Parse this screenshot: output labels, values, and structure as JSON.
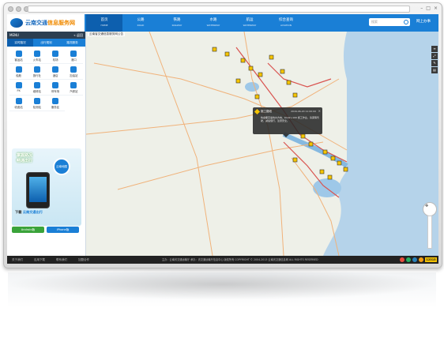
{
  "header": {
    "logo_text": "云南交通",
    "logo_sub": "信息服务网",
    "tabs": [
      {
        "cn": "首页",
        "en": "HOME"
      },
      {
        "cn": "公路",
        "en": "ROAD"
      },
      {
        "cn": "铁路",
        "en": "RAILWAY"
      },
      {
        "cn": "水路",
        "en": "WATERWAY"
      },
      {
        "cn": "航运",
        "en": "WATERWAY"
      },
      {
        "cn": "综合查询",
        "en": "AVIATION"
      }
    ],
    "search_placeholder": "搜索",
    "online_label": "网上办事"
  },
  "sidebar": {
    "menu_label": "MENU",
    "menu_right": "« 返回",
    "tabs": [
      "实时路况",
      "出行规划",
      "路况服务"
    ],
    "grid": [
      {
        "label": "客运站",
        "icon": "bus-icon"
      },
      {
        "label": "火车站",
        "icon": "train-icon"
      },
      {
        "label": "机场",
        "icon": "plane-icon"
      },
      {
        "label": "港口",
        "icon": "port-icon"
      },
      {
        "label": "船舶",
        "icon": "ship-icon"
      },
      {
        "label": "旅行社",
        "icon": "travel-icon"
      },
      {
        "label": "酒店",
        "icon": "hotel-icon"
      },
      {
        "label": "加油站",
        "icon": "fuel-icon"
      },
      {
        "label": "PX",
        "icon": "px-icon"
      },
      {
        "label": "维修站",
        "icon": "repair-icon"
      },
      {
        "label": "停车场",
        "icon": "parking-icon"
      },
      {
        "label": "汽修站",
        "icon": "car-repair-icon"
      },
      {
        "label": "收费站",
        "icon": "toll-icon"
      },
      {
        "label": "检测站",
        "icon": "inspect-icon"
      },
      {
        "label": "服务区",
        "icon": "service-icon"
      }
    ],
    "ad": {
      "slogan_1": "掌握路况",
      "slogan_2": "畅通出行",
      "badge": "云南地图",
      "download_prefix": "下载",
      "download_app": "云南交通出行"
    },
    "downloads": {
      "android": "Android版",
      "ios": "iPhone版"
    }
  },
  "map": {
    "breadcrumb": "云南省交通信息服务网公告",
    "popup": {
      "title": "施工路段",
      "time": "2016-06-20  11:00:00",
      "body": "杭金衢高速杭州方向，K142+100 施工作业，请谨慎驾驶，减速慢行，注意安全。"
    }
  },
  "footer": {
    "links": [
      "关于我们",
      "应用下载",
      "联系我们",
      "加盟合作"
    ],
    "copyright": "主办：云南省交通运输厅    承办：省交通运输厅信息中心    版权所有 COPYRIGHT © 2004-2013 云南省交通信息网 ALL RIGHTS RESERVED",
    "badge": "12315"
  },
  "colors": {
    "brand": "#1a7fd6",
    "accent": "#f08a00",
    "warning": "#f5c400"
  }
}
